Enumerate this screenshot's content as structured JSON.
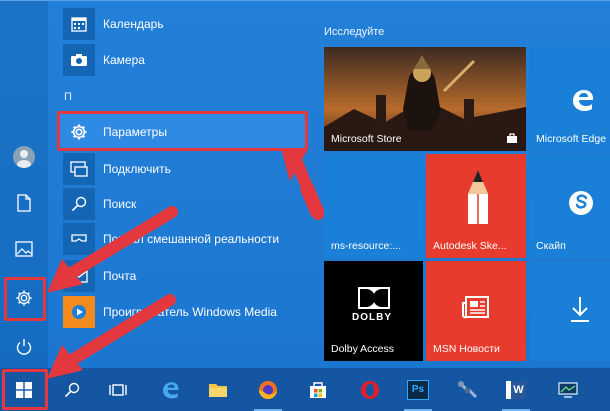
{
  "apps": [
    {
      "label": "Календарь",
      "icon": "calendar-icon"
    },
    {
      "label": "Камера",
      "icon": "camera-icon"
    },
    {
      "label": "Параметры",
      "icon": "gear-icon"
    },
    {
      "label": "Подключить",
      "icon": "connect-icon"
    },
    {
      "label": "Поиск",
      "icon": "search-icon"
    },
    {
      "label": "Портал смешанной реальности",
      "icon": "mixed-reality-icon"
    },
    {
      "label": "Почта",
      "icon": "mail-icon"
    },
    {
      "label": "Проигрыватель Windows Media",
      "icon": "media-player-icon"
    }
  ],
  "letter_header": "П",
  "section_title": "Исследуйте",
  "tiles": {
    "store": "Microsoft Store",
    "edge": "Microsoft Edge",
    "ms_resource": "ms-resource:...",
    "autodesk": "Autodesk Ske...",
    "skype": "Скайп",
    "dolby": "Dolby Access",
    "dolby_logo": "DOLBY",
    "msn": "MSN Новости"
  },
  "colors": {
    "start_bg": "#1b76cf",
    "tile_red": "#e73b2e",
    "tile_blue": "#1a7fd6",
    "highlight": "#e4383f",
    "taskbar": "#1556a3"
  },
  "taskbar_items": [
    "windows-logo-icon",
    "search-icon",
    "task-view-icon",
    "edge-icon",
    "file-explorer-icon",
    "firefox-icon",
    "store-icon",
    "opera-icon",
    "photoshop-icon",
    "network-tool-icon",
    "word-icon",
    "monitor-icon"
  ],
  "taskbar_labels": {
    "photoshop": "Ps",
    "word": "W"
  }
}
